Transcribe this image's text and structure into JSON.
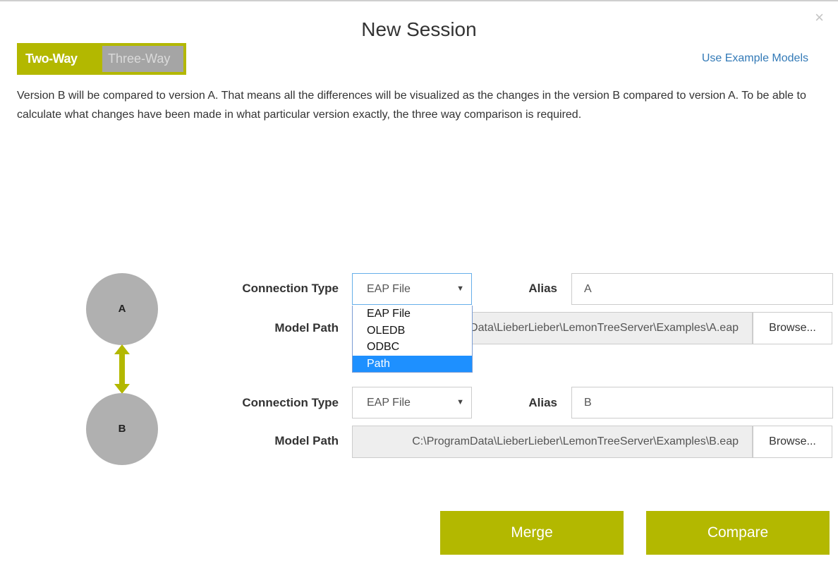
{
  "dialog": {
    "title": "New Session",
    "close_glyph": "×",
    "close_icon": "close-icon"
  },
  "mode_toggle": {
    "two_way": "Two-Way",
    "three_way": "Three-Way",
    "selected": "Two-Way"
  },
  "example_link": "Use Example Models",
  "description": "Version B will be compared to version A. That means all the differences will be visualized as the changes in the version B compared to version A. To be able to calculate what changes have been made in what particular version exactly, the three way comparison is required.",
  "model_a": {
    "circle_label": "A",
    "connection_type_label": "Connection Type",
    "connection_type_value": "EAP File",
    "alias_label": "Alias",
    "alias_value": "A",
    "model_path_label": "Model Path",
    "model_path_value": "C:\\ProgramData\\LieberLieber\\LemonTreeServer\\Examples\\A.eap",
    "browse_label": "Browse..."
  },
  "model_b": {
    "circle_label": "B",
    "connection_type_label": "Connection Type",
    "connection_type_value": "EAP File",
    "alias_label": "Alias",
    "alias_value": "B",
    "model_path_label": "Model Path",
    "model_path_value": "C:\\ProgramData\\LieberLieber\\LemonTreeServer\\Examples\\B.eap",
    "browse_label": "Browse..."
  },
  "connection_type_options": [
    "EAP File",
    "OLEDB",
    "ODBC",
    "Path"
  ],
  "highlighted_option": "Path",
  "caret_glyph": "▼",
  "actions": {
    "merge": "Merge",
    "compare": "Compare"
  },
  "colors": {
    "accent": "#b3b800",
    "inactive_tab": "#a5a5a5",
    "link": "#337ab7",
    "circle": "#b0b0b0",
    "dropdown_highlight": "#1e90ff"
  }
}
